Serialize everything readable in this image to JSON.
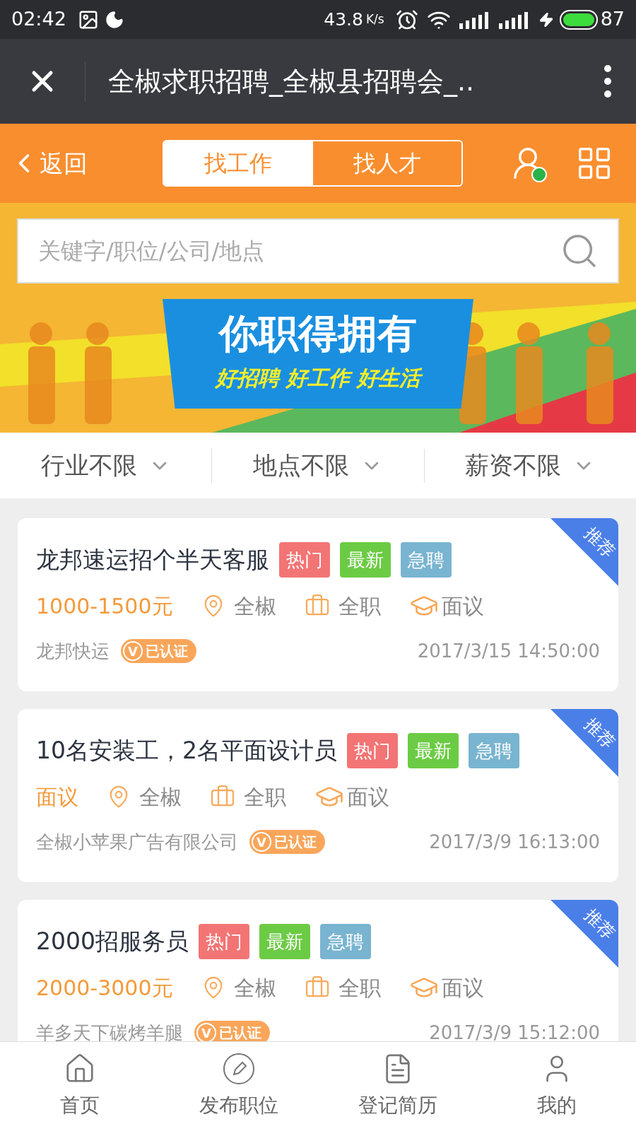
{
  "status_bar": {
    "time": "02:42",
    "speed": "43.8",
    "speed_unit": "K/s",
    "battery": "87"
  },
  "browser": {
    "title": "全椒求职招聘_全椒县招聘会_.."
  },
  "header": {
    "back": "返回",
    "tabs": [
      {
        "label": "找工作",
        "selected": true
      },
      {
        "label": "找人才",
        "selected": false
      }
    ]
  },
  "search": {
    "placeholder": "关键字/职位/公司/地点"
  },
  "banner": {
    "headline": "你职得拥有",
    "slogan": "好招聘 好工作 好生活"
  },
  "filters": [
    "行业不限",
    "地点不限",
    "薪资不限"
  ],
  "jobs": [
    {
      "title": "龙邦速运招个半天客服",
      "tags": [
        {
          "label": "热门",
          "color": "#f37474"
        },
        {
          "label": "最新",
          "color": "#6ccb44"
        },
        {
          "label": "急聘",
          "color": "#79b4d0"
        }
      ],
      "salary": "1000-1500元",
      "location": "全椒",
      "type": "全职",
      "education": "面议",
      "company": "龙邦快运",
      "verified_mark": "V",
      "verified": "已认证",
      "time": "2017/3/15 14:50:00",
      "ribbon": "推荐"
    },
    {
      "title": "10名安装工，2名平面设计员",
      "tags": [
        {
          "label": "热门",
          "color": "#f37474"
        },
        {
          "label": "最新",
          "color": "#6ccb44"
        },
        {
          "label": "急聘",
          "color": "#79b4d0"
        }
      ],
      "salary": "面议",
      "location": "全椒",
      "type": "全职",
      "education": "面议",
      "company": "全椒小苹果广告有限公司",
      "verified_mark": "V",
      "verified": "已认证",
      "time": "2017/3/9 16:13:00",
      "ribbon": "推荐"
    },
    {
      "title": "2000招服务员",
      "tags": [
        {
          "label": "热门",
          "color": "#f37474"
        },
        {
          "label": "最新",
          "color": "#6ccb44"
        },
        {
          "label": "急聘",
          "color": "#79b4d0"
        }
      ],
      "salary": "2000-3000元",
      "location": "全椒",
      "type": "全职",
      "education": "面议",
      "company": "羊多天下碳烤羊腿",
      "verified_mark": "V",
      "verified": "已认证",
      "time": "2017/3/9 15:12:00",
      "ribbon": "推荐"
    }
  ],
  "nav": [
    {
      "kind": "home",
      "label": "首页"
    },
    {
      "kind": "post",
      "label": "发布职位"
    },
    {
      "kind": "resume",
      "label": "登记简历"
    },
    {
      "kind": "user",
      "label": "我的"
    }
  ]
}
